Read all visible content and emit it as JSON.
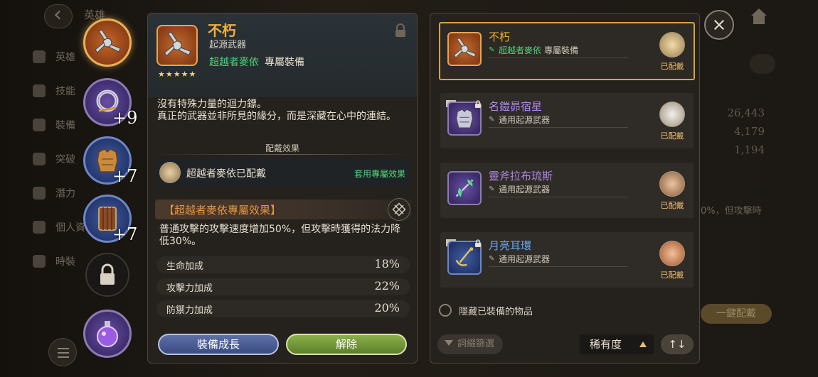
{
  "background": {
    "title": "英雄",
    "nav": [
      "英雄",
      "技能",
      "裝備",
      "突破",
      "潛力",
      "個人資料",
      "時裝"
    ],
    "stats": [
      "26,443",
      "4,179",
      "1,194"
    ],
    "wear_button": "一鍵配戴",
    "fragment_text": "0%，但攻擊時"
  },
  "slots": {
    "ring_plus": "+9",
    "armor_plus": "+7",
    "shield_plus": "+7"
  },
  "detail": {
    "name": "不朽",
    "type": "起源武器",
    "hero": "超越者麥依",
    "exclusive_tag": "專屬裝備",
    "stars": 5,
    "description": [
      "沒有特殊力量的迴力鏢。",
      "真正的武器並非所見的緣分，而是深藏在心中的連結。"
    ],
    "section_title": "配戴效果",
    "equipped_text": "超越者麥依已配戴",
    "apply_link": "套用專屬效果",
    "effect_title": "【超越者麥依專屬效果】",
    "effect_desc": "普通攻擊的攻擊速度增加50%，但攻擊時獲得的法力降低30%。",
    "stats": [
      {
        "label": "生命加成",
        "value": "18%"
      },
      {
        "label": "攻擊力加成",
        "value": "22%"
      },
      {
        "label": "防禦力加成",
        "value": "20%"
      }
    ],
    "growth_button": "裝備成長",
    "remove_button": "解除"
  },
  "list": {
    "items": [
      {
        "name": "不朽",
        "hero": "超越者麥依",
        "sub": "專屬裝備",
        "equipped": "已配戴",
        "color": "gold"
      },
      {
        "name": "名鎧昴宿星",
        "sub": "通用起源武器",
        "equipped": "已配戴",
        "color": "violet"
      },
      {
        "name": "靈斧拉布琉斯",
        "sub": "通用起源武器",
        "equipped": "已配戴",
        "color": "violet"
      },
      {
        "name": "月亮耳環",
        "sub": "通用起源武器",
        "equipped": "已配戴",
        "color": "blue"
      }
    ],
    "hide_label": "隱藏已裝備的物品",
    "filter_label": "詞綴篩選",
    "sort_label": "稀有度",
    "order_label": "↑↓"
  },
  "icons": {
    "close": "close-icon",
    "lock": "lock-icon",
    "home": "home-icon",
    "search": "search-icon",
    "filter": "filter-icon",
    "list": "list-icon"
  },
  "colors": {
    "gold": "#f0b03c",
    "green": "#4fd27a",
    "violet": "#b08ae8",
    "blue": "#6aa7ec"
  }
}
